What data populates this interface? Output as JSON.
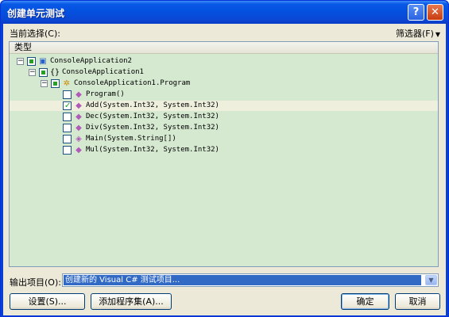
{
  "window": {
    "title": "创建单元测试"
  },
  "title_buttons": {
    "help": "?",
    "close": "✕"
  },
  "current_selection_label": "当前选择(C):",
  "filter_button": "筛选器(F)",
  "tree": {
    "column_header": "类型",
    "items": [
      {
        "label": "ConsoleApplication2",
        "icon": "project-icon",
        "checkbox": "partial"
      },
      {
        "label": "ConsoleApplication1",
        "icon": "namespace-icon",
        "checkbox": "partial"
      },
      {
        "label": "ConsoleApplication1.Program",
        "icon": "class-icon",
        "checkbox": "partial"
      },
      {
        "label": "Program()",
        "icon": "method-icon",
        "checkbox": "unchecked"
      },
      {
        "label": "Add(System.Int32, System.Int32)",
        "icon": "method-icon",
        "checkbox": "checked"
      },
      {
        "label": "Dec(System.Int32, System.Int32)",
        "icon": "method-icon",
        "checkbox": "unchecked"
      },
      {
        "label": "Div(System.Int32, System.Int32)",
        "icon": "method-icon",
        "checkbox": "unchecked"
      },
      {
        "label": "Main(System.String[])",
        "icon": "static-method-icon",
        "checkbox": "unchecked"
      },
      {
        "label": "Mul(System.Int32, System.Int32)",
        "icon": "method-icon",
        "checkbox": "unchecked"
      }
    ]
  },
  "output": {
    "label": "输出项目(O):",
    "value": "创建新的 Visual C# 测试项目..."
  },
  "buttons": {
    "settings": "设置(S)...",
    "add_assembly": "添加程序集(A)...",
    "ok": "确定",
    "cancel": "取消"
  },
  "colors": {
    "tree_background": "#d5e8d0",
    "selection": "#316ac5",
    "titlebar": "#0a58e6"
  }
}
